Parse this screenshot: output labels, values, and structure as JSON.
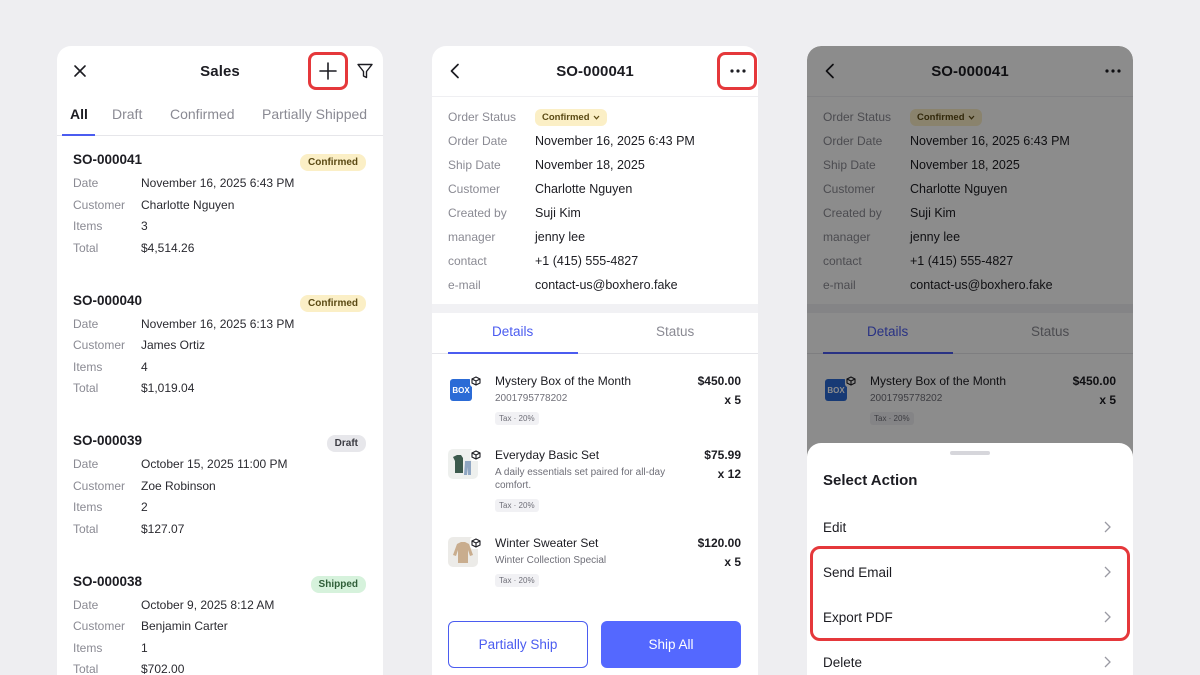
{
  "sales_list": {
    "title": "Sales",
    "tabs": [
      "All",
      "Draft",
      "Confirmed",
      "Partially Shipped"
    ],
    "labels": {
      "date": "Date",
      "customer": "Customer",
      "items": "Items",
      "total": "Total"
    },
    "orders": [
      {
        "id": "SO-000041",
        "status": "Confirmed",
        "date": "November 16, 2025 6:43 PM",
        "customer": "Charlotte Nguyen",
        "items": "3",
        "total": "$4,514.26"
      },
      {
        "id": "SO-000040",
        "status": "Confirmed",
        "date": "November 16, 2025 6:13 PM",
        "customer": "James Ortiz",
        "items": "4",
        "total": "$1,019.04"
      },
      {
        "id": "SO-000039",
        "status": "Draft",
        "date": "October 15, 2025 11:00 PM",
        "customer": "Zoe Robinson",
        "items": "2",
        "total": "$127.07"
      },
      {
        "id": "SO-000038",
        "status": "Shipped",
        "date": "October 9, 2025 8:12 AM",
        "customer": "Benjamin Carter",
        "items": "1",
        "total": "$702.00"
      }
    ]
  },
  "order_detail": {
    "title": "SO-000041",
    "fields": [
      {
        "label": "Order Status",
        "value": "Confirmed"
      },
      {
        "label": "Order Date",
        "value": "November 16, 2025 6:43 PM"
      },
      {
        "label": "Ship Date",
        "value": "November 18, 2025"
      },
      {
        "label": "Customer",
        "value": "Charlotte Nguyen"
      },
      {
        "label": "Created by",
        "value": "Suji Kim"
      },
      {
        "label": "manager",
        "value": "jenny lee"
      },
      {
        "label": "contact",
        "value": "+1 (415) 555-4827"
      },
      {
        "label": "e-mail",
        "value": "contact-us@boxhero.fake"
      }
    ],
    "tabs": [
      "Details",
      "Status"
    ],
    "items": [
      {
        "name": "Mystery Box of the Month",
        "sub": "2001795778202",
        "tax": "Tax · 20%",
        "price": "$450.00",
        "qty": "x 5",
        "icon": "mystery-box-icon",
        "thumb_text": "BOX"
      },
      {
        "name": "Everyday Basic Set",
        "sub": "A daily essentials set paired for all-day comfort.",
        "tax": "Tax · 20%",
        "price": "$75.99",
        "qty": "x 12",
        "icon": "clothing-set-icon"
      },
      {
        "name": "Winter Sweater Set",
        "sub": "Winter Collection Special",
        "tax": "Tax · 20%",
        "price": "$120.00",
        "qty": "x 5",
        "icon": "sweater-icon"
      }
    ],
    "buttons": {
      "partial": "Partially Ship",
      "ship_all": "Ship All"
    }
  },
  "action_sheet": {
    "title": "Select Action",
    "actions": [
      "Edit",
      "Send Email",
      "Export PDF",
      "Delete"
    ]
  },
  "colors": {
    "accent": "#4b5cf0",
    "highlight": "#e5383b",
    "confirmed_bg": "#fbefc6",
    "shipped_bg": "#d6f2dc"
  }
}
